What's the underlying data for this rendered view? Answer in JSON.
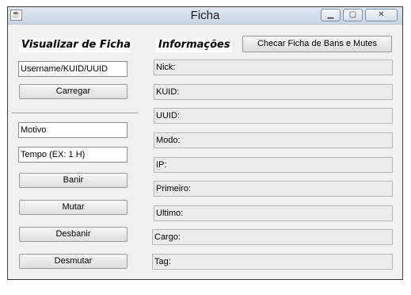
{
  "window": {
    "title": "Ficha",
    "app_icon": "java-icon",
    "controls": [
      "minimize-icon",
      "maximize-icon",
      "close-icon"
    ]
  },
  "left": {
    "heading": "Visualizar de Ficha",
    "user_field": "Username/KUID/UUID",
    "load_button": "Carregar",
    "reason_field": "Motivo",
    "time_field": "Tempo (EX: 1 H)",
    "ban_button": "Banir",
    "mute_button": "Mutar",
    "unban_button": "Desbanir",
    "unmute_button": "Desmutar"
  },
  "right": {
    "heading": "Informações",
    "check_button": "Checar Ficha de Bans e Mutes",
    "fields": [
      "Nick:",
      "KUID:",
      "UUID:",
      "Modo:",
      "IP:",
      "Primeiro:",
      "Ultimo:",
      "Cargo:",
      "Tag:"
    ]
  }
}
